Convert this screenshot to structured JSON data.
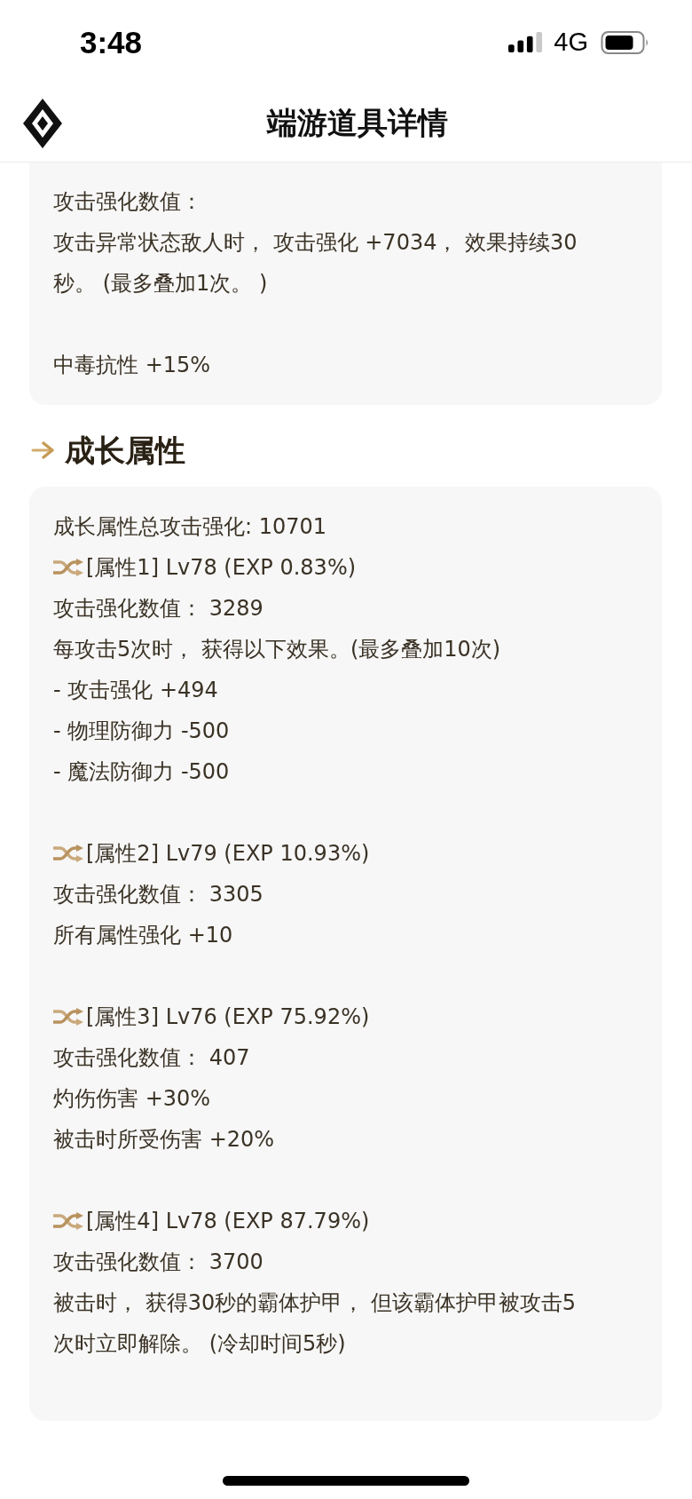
{
  "status_bar": {
    "time": "3:48",
    "network": "4G"
  },
  "header": {
    "title": "端游道具详情"
  },
  "effect_card": {
    "paragraphs": [
      [
        "攻击强化数值：",
        "攻击异常状态敌人时， 攻击强化 +7034， 效果持续30秒。 (最多叠加1次。 )"
      ],
      [
        "中毒抗性 +15%"
      ]
    ]
  },
  "growth_section": {
    "title": "成长属性",
    "summary": "成长属性总攻击强化: 10701",
    "attributes": [
      {
        "title": "[属性1] Lv78 (EXP 0.83%)",
        "lines": [
          "攻击强化数值： 3289",
          "每攻击5次时， 获得以下效果。(最多叠加10次)",
          "- 攻击强化 +494",
          "- 物理防御力 -500",
          "- 魔法防御力 -500"
        ]
      },
      {
        "title": "[属性2] Lv79 (EXP 10.93%)",
        "lines": [
          "攻击强化数值： 3305",
          "所有属性强化 +10"
        ]
      },
      {
        "title": "[属性3] Lv76 (EXP 75.92%)",
        "lines": [
          "攻击强化数值： 407",
          "灼伤伤害 +30%",
          "被击时所受伤害 +20%"
        ]
      },
      {
        "title": "[属性4] Lv78 (EXP 87.79%)",
        "lines": [
          "攻击强化数值： 3700",
          "被击时， 获得30秒的霸体护甲， 但该霸体护甲被攻击5次时立即解除。 (冷却时间5秒)"
        ]
      }
    ]
  }
}
